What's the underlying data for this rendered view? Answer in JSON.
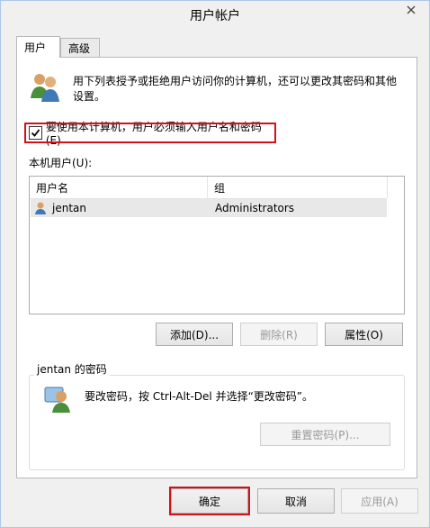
{
  "window": {
    "title": "用户帐户"
  },
  "tabs": [
    {
      "label": "用户"
    },
    {
      "label": "高级"
    }
  ],
  "intro": {
    "text_line1": "用下列表授予或拒绝用户访问你的计算机，还可以更改其密码和其他",
    "text_line2": "设置。"
  },
  "require_login": {
    "label": "要使用本计算机，用户必须输入用户名和密码(E)",
    "checked": true
  },
  "users_list": {
    "caption": "本机用户(U):",
    "columns": [
      "用户名",
      "组"
    ],
    "rows": [
      {
        "name": "jentan",
        "group": "Administrators"
      }
    ]
  },
  "list_buttons": {
    "add": "添加(D)...",
    "remove": "删除(R)",
    "properties": "属性(O)"
  },
  "password_group": {
    "title": "jentan 的密码",
    "text": "要改密码，按 Ctrl-Alt-Del 并选择“更改密码”。",
    "reset": "重置密码(P)..."
  },
  "footer": {
    "ok": "确定",
    "cancel": "取消",
    "apply": "应用(A)"
  },
  "colors": {
    "highlight_red": "#d0121b",
    "selection_row": "#e8e8e8"
  }
}
